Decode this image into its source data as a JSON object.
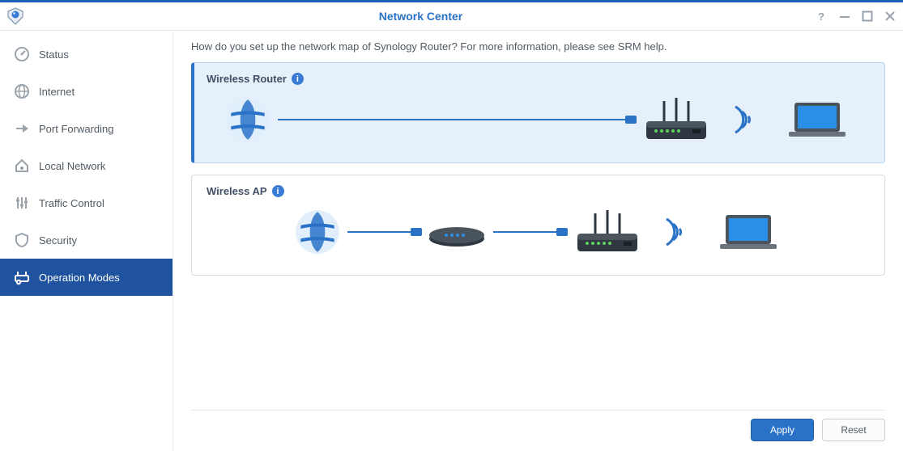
{
  "window": {
    "title": "Network Center"
  },
  "sidebar": {
    "items": [
      {
        "label": "Status"
      },
      {
        "label": "Internet"
      },
      {
        "label": "Port Forwarding"
      },
      {
        "label": "Local Network"
      },
      {
        "label": "Traffic Control"
      },
      {
        "label": "Security"
      },
      {
        "label": "Operation Modes"
      }
    ],
    "active_index": 6
  },
  "main": {
    "intro": "How do you set up the network map of Synology Router? For more information, please see SRM help.",
    "modes": [
      {
        "title": "Wireless Router",
        "selected": true
      },
      {
        "title": "Wireless AP",
        "selected": false
      }
    ]
  },
  "footer": {
    "apply": "Apply",
    "reset": "Reset"
  }
}
